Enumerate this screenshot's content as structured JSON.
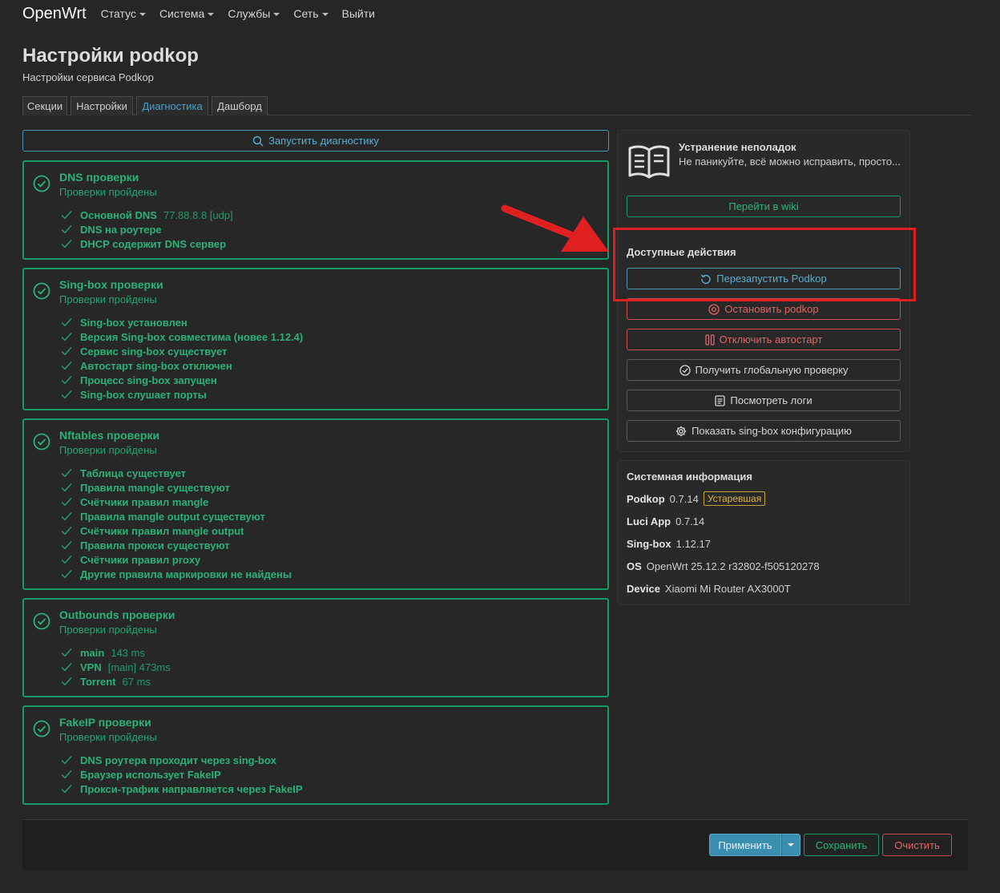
{
  "nav": {
    "brand": "OpenWrt",
    "items": [
      "Статус",
      "Система",
      "Службы",
      "Сеть"
    ],
    "logout": "Выйти"
  },
  "page": {
    "title": "Настройки podkop",
    "subtitle": "Настройки сервиса Podkop"
  },
  "tabs": [
    "Секции",
    "Настройки",
    "Диагностика",
    "Дашборд"
  ],
  "active_tab": "Диагностика",
  "run_diagnostics": "Запустить диагностику",
  "checks": [
    {
      "title": "DNS проверки",
      "status": "Проверки пройдены",
      "items": [
        {
          "label": "Основной DNS",
          "value": "77.88.8.8 [udp]"
        },
        {
          "label": "DNS на роутере",
          "value": ""
        },
        {
          "label": "DHCP содержит DNS сервер",
          "value": ""
        }
      ]
    },
    {
      "title": "Sing-box проверки",
      "status": "Проверки пройдены",
      "items": [
        {
          "label": "Sing-box установлен",
          "value": ""
        },
        {
          "label": "Версия Sing-box совместима (новее 1.12.4)",
          "value": ""
        },
        {
          "label": "Сервис sing-box существует",
          "value": ""
        },
        {
          "label": "Автостарт sing-box отключен",
          "value": ""
        },
        {
          "label": "Процесс sing-box запущен",
          "value": ""
        },
        {
          "label": "Sing-box слушает порты",
          "value": ""
        }
      ]
    },
    {
      "title": "Nftables проверки",
      "status": "Проверки пройдены",
      "items": [
        {
          "label": "Таблица существует",
          "value": ""
        },
        {
          "label": "Правила mangle существуют",
          "value": ""
        },
        {
          "label": "Счётчики правил mangle",
          "value": ""
        },
        {
          "label": "Правила mangle output существуют",
          "value": ""
        },
        {
          "label": "Счётчики правил mangle output",
          "value": ""
        },
        {
          "label": "Правила прокси существуют",
          "value": ""
        },
        {
          "label": "Счётчики правил proxy",
          "value": ""
        },
        {
          "label": "Другие правила маркировки не найдены",
          "value": ""
        }
      ]
    },
    {
      "title": "Outbounds проверки",
      "status": "Проверки пройдены",
      "items": [
        {
          "label": "main",
          "value": "143 ms"
        },
        {
          "label": "VPN",
          "value": "[main] 473ms"
        },
        {
          "label": "Torrent",
          "value": "67 ms"
        }
      ]
    },
    {
      "title": "FakeIP проверки",
      "status": "Проверки пройдены",
      "items": [
        {
          "label": "DNS роутера проходит через sing-box",
          "value": ""
        },
        {
          "label": "Браузер использует FakeIP",
          "value": ""
        },
        {
          "label": "Прокси-трафик направляется через FakeIP",
          "value": ""
        }
      ]
    }
  ],
  "troubleshoot": {
    "title": "Устранение неполадок",
    "text": "Не паникуйте, всё можно исправить, просто...",
    "wiki_button": "Перейти в wiki"
  },
  "actions": {
    "title": "Доступные действия",
    "restart": "Перезапустить Podkop",
    "stop": "Остановить podkop",
    "disable_autostart": "Отключить автостарт",
    "global_check": "Получить глобальную проверку",
    "view_logs": "Посмотреть логи",
    "show_config": "Показать sing-box конфигурацию"
  },
  "system": {
    "title": "Системная информация",
    "rows": [
      {
        "key": "Podkop",
        "value": "0.7.14",
        "badge": "Устаревшая"
      },
      {
        "key": "Luci App",
        "value": "0.7.14",
        "badge": ""
      },
      {
        "key": "Sing-box",
        "value": "1.12.17",
        "badge": ""
      },
      {
        "key": "OS",
        "value": "OpenWrt 25.12.2 r32802-f505120278",
        "badge": ""
      },
      {
        "key": "Device",
        "value": "Xiaomi Mi Router AX3000T",
        "badge": ""
      }
    ]
  },
  "footer": {
    "apply": "Применить",
    "save": "Сохранить",
    "clear": "Очистить"
  },
  "colors": {
    "accent_green": "#2bb178",
    "accent_blue": "#5aaed0",
    "danger_red": "#e06464",
    "annotation_red": "#e02020",
    "badge_gold": "#d8b44a"
  }
}
